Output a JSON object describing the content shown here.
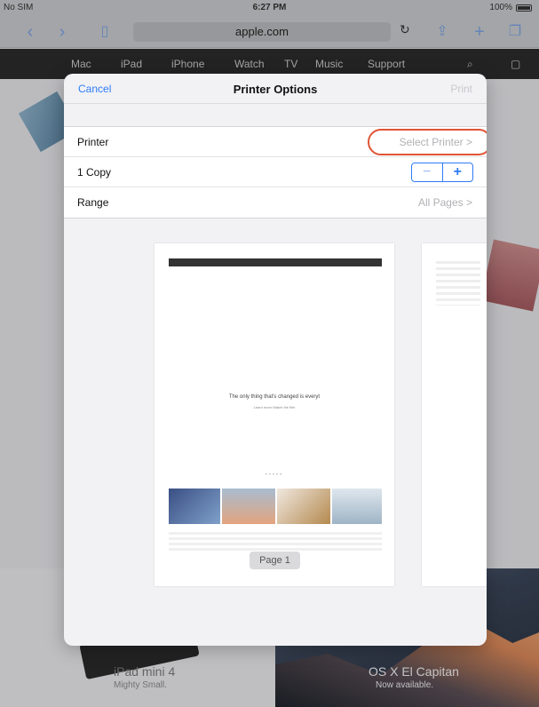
{
  "status_bar": {
    "carrier": "No SIM",
    "time": "6:27 PM",
    "battery": "100%"
  },
  "safari": {
    "address": "apple.com"
  },
  "apple_nav": {
    "items": [
      "Mac",
      "iPad",
      "iPhone",
      "Watch",
      "TV",
      "Music",
      "Support"
    ]
  },
  "modal": {
    "cancel_label": "Cancel",
    "title": "Printer Options",
    "print_label": "Print",
    "rows": [
      {
        "label": "Printer",
        "value": "Select Printer >"
      },
      {
        "label": "1 Copy"
      },
      {
        "label": "Range",
        "value": "All Pages >"
      }
    ],
    "stepper": {
      "minus": "−",
      "plus": "+"
    }
  },
  "preview": {
    "headline": "The only thing that's changed is everyt",
    "links": "Learn more  Watch the film",
    "page_label": "Page 1"
  },
  "background": {
    "ipad_mini": "iPad mini 4",
    "ipad_mini_sub": "Mighty Small.",
    "os": "OS X El Capitan",
    "os_sub": "Now available."
  }
}
